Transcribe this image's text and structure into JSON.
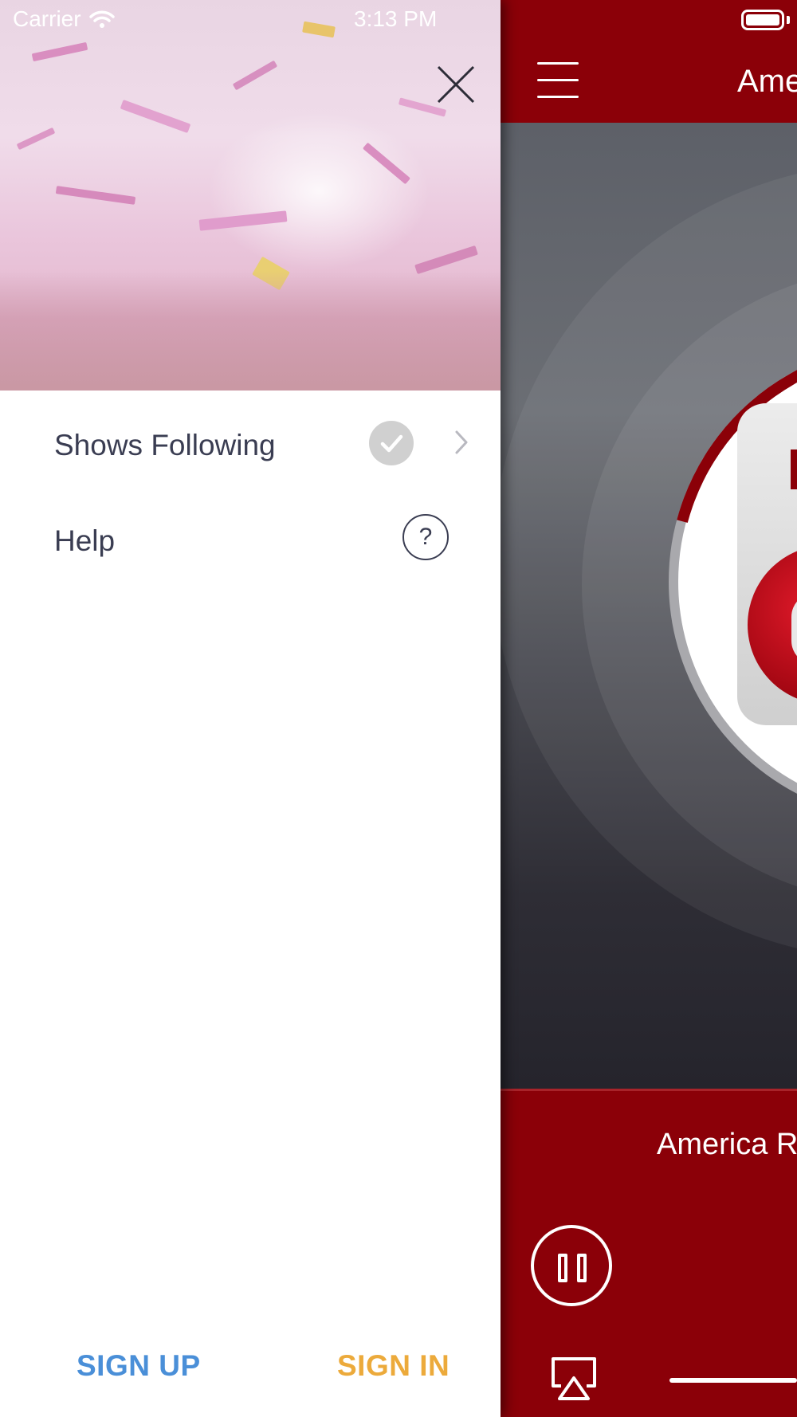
{
  "status_bar": {
    "carrier": "Carrier",
    "time": "3:13 PM"
  },
  "drawer": {
    "menu_items": [
      {
        "label": "Shows Following",
        "icon": "checkmark-icon",
        "accessory": "chevron-right-icon"
      },
      {
        "label": "Help",
        "icon": "question-mark-icon"
      }
    ],
    "help_glyph": "?",
    "footer": {
      "sign_up_label": "SIGN UP",
      "sign_in_label": "SIGN IN"
    }
  },
  "main": {
    "nav_title": "Ame",
    "now_playing": "America R",
    "controls": [
      "pause-icon",
      "airplay-icon",
      "volume-slider"
    ]
  },
  "colors": {
    "brand_red": "#8b0008",
    "sign_up": "#4a8fd8",
    "sign_in": "#ecaa3b",
    "menu_text": "#3a3d52"
  }
}
